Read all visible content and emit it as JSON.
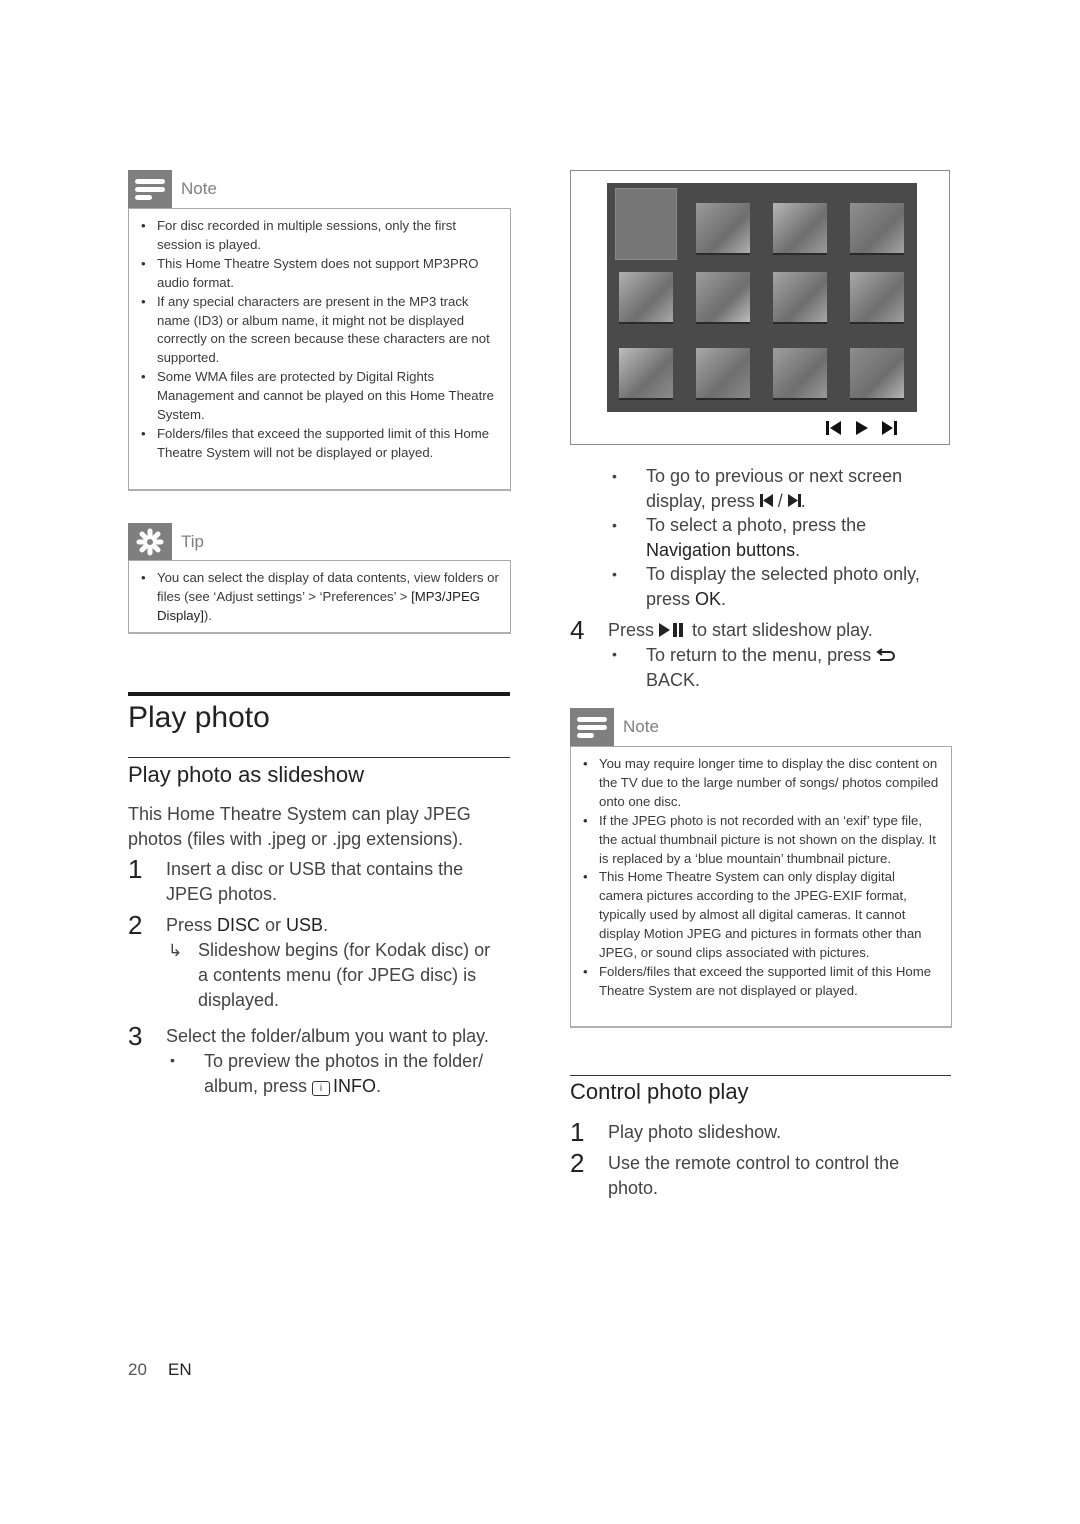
{
  "left_note": {
    "title": "Note",
    "icon": "note-lines-icon",
    "items": [
      "For disc recorded in multiple sessions, only the first session is played.",
      "This Home Theatre System does not support MP3PRO audio format.",
      "If any special characters are present in the MP3 track name (ID3) or album name, it might not be displayed correctly on the screen because these characters are not supported.",
      "Some WMA files are protected by Digital Rights Management and cannot be played on this Home Theatre System.",
      "Folders/files that exceed the supported limit of this Home Theatre System will not be displayed or played."
    ]
  },
  "tip": {
    "title": "Tip",
    "icon": "asterisk-tip-icon",
    "item_prefix": "You can select the display of data contents, view folders or files (see ‘Adjust settings’ > ‘Preferences’ > ",
    "item_bold": "[MP3/JPEG Display]",
    "item_suffix": ")."
  },
  "section": {
    "title": "Play photo",
    "subsection": "Play photo as slideshow",
    "intro": "This Home Theatre System can play JPEG photos (files with .jpeg or .jpg extensions).",
    "steps": [
      {
        "num": "1",
        "text": "Insert a disc or USB that contains the JPEG photos."
      },
      {
        "num": "2",
        "text_pre": "Press ",
        "bold1": "DISC",
        "mid": " or ",
        "bold2": "USB",
        "post": ".",
        "result_icon": "arrow-result-icon",
        "result": "Slideshow begins (for Kodak disc) or a contents menu (for JPEG disc) is displayed."
      },
      {
        "num": "3",
        "text": "Select the folder/album you want to play.",
        "bullet_pre": "To preview the photos in the folder/ album, press ",
        "bullet_icon": "info-icon",
        "bullet_bold": "INFO",
        "bullet_post": "."
      }
    ]
  },
  "figure": {
    "thumbnail_count": 12,
    "selected_index": 0,
    "controls": [
      "previous-icon",
      "play-icon",
      "next-icon"
    ]
  },
  "right_steps": {
    "bullets": [
      {
        "pre": "To go to previous or next screen display, press ",
        "post": " / ",
        "end": "."
      },
      {
        "pre": "To select a photo, press the ",
        "bold": "Navigation buttons",
        "end": "."
      },
      {
        "pre": "To display the selected photo only, press ",
        "bold": "OK",
        "end": "."
      }
    ],
    "step4": {
      "num": "4",
      "pre": "Press ",
      "post": " to start slideshow play.",
      "bullet_pre": "To return to the menu, press ",
      "bullet_bold": "BACK",
      "bullet_end": "."
    }
  },
  "right_note": {
    "title": "Note",
    "items": [
      "You may require longer time to display the disc content on the TV due to the large number of songs/ photos compiled onto one disc.",
      "If the JPEG photo is not recorded with an ‘exif’ type file, the actual thumbnail picture is not shown on the display. It is replaced by a ‘blue mountain’ thumbnail picture.",
      "This Home Theatre System can only display digital camera pictures according to the JPEG-EXIF format, typically used by almost all digital cameras. It cannot display Motion JPEG and pictures in formats other than JPEG, or sound clips associated with pictures.",
      "Folders/files that exceed the supported limit of this Home Theatre System are not displayed or played."
    ]
  },
  "control": {
    "title": "Control photo play",
    "steps": [
      {
        "num": "1",
        "text": "Play photo slideshow."
      },
      {
        "num": "2",
        "text": "Use the remote control to control the photo."
      }
    ]
  },
  "footer": {
    "page": "20",
    "lang": "EN"
  }
}
